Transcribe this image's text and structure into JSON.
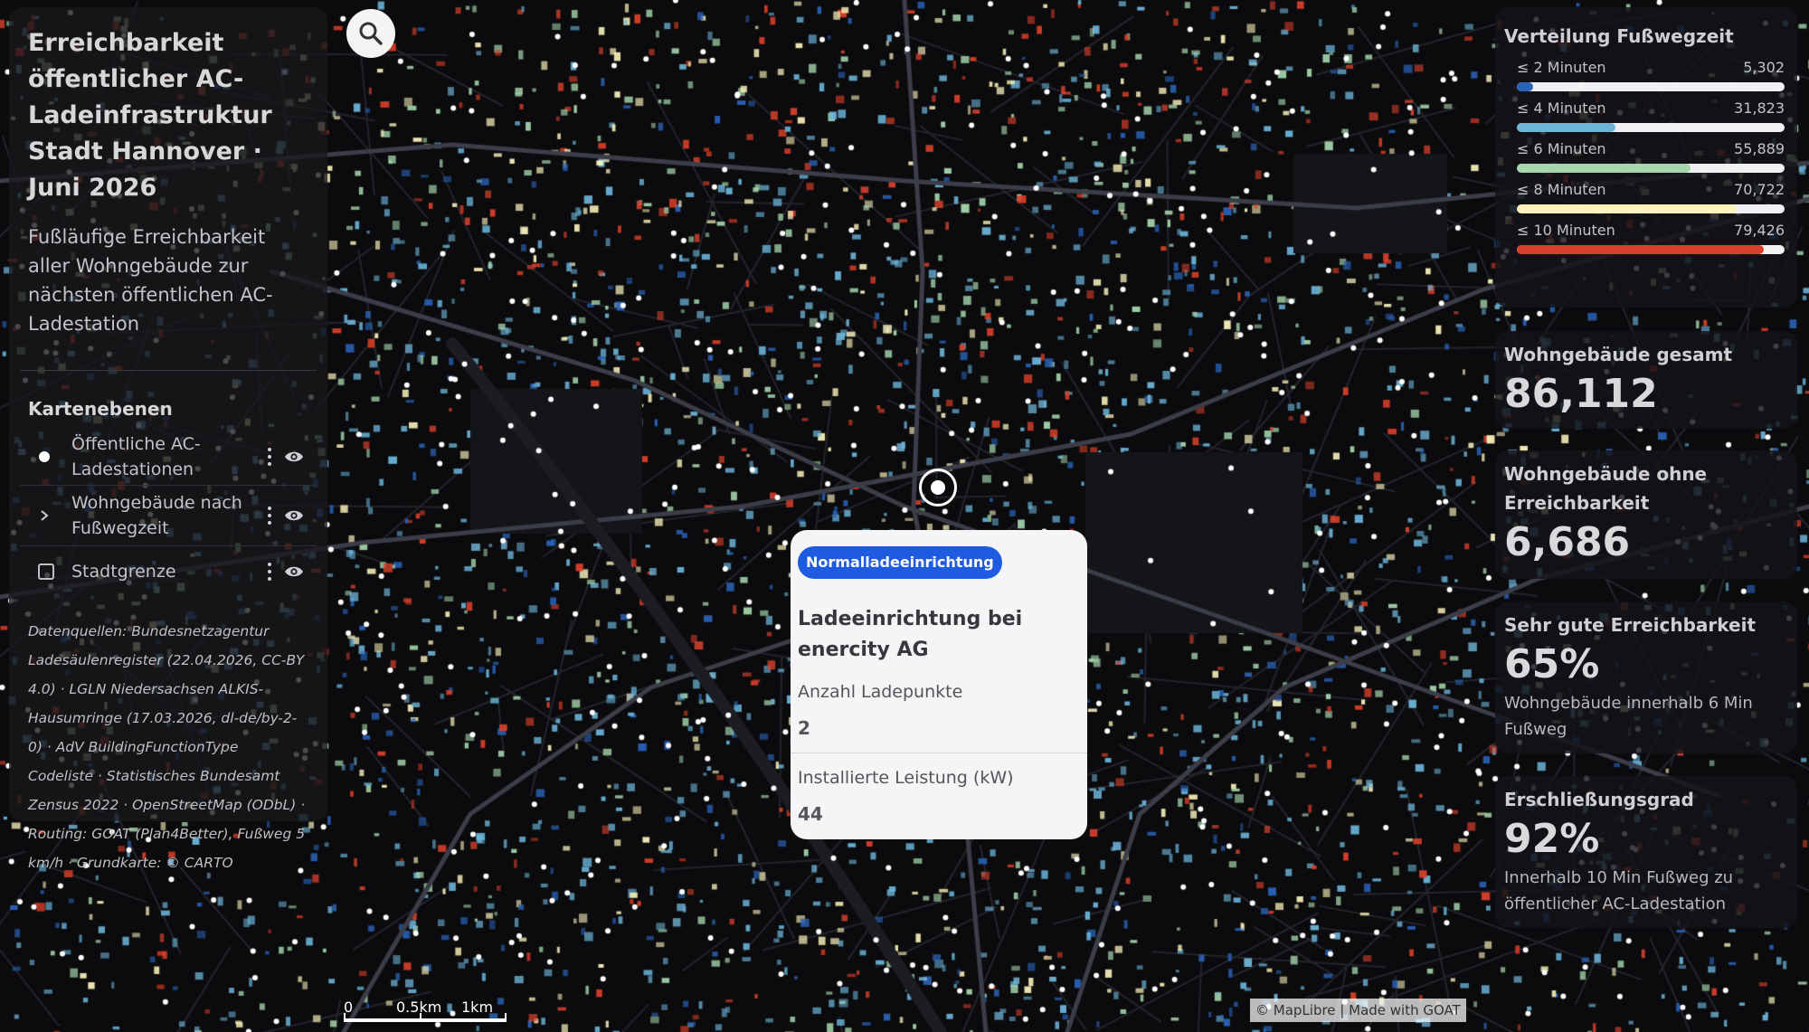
{
  "app": {
    "title": "Erreichbarkeit öffentlicher AC-Ladeinfrastruktur Stadt Hannover · Juni 2026",
    "subtitle": "Fußläufige Erreichbarkeit aller Wohngebäude zur nächsten öffentlichen AC-Ladestation"
  },
  "layers": {
    "heading": "Kartenebenen",
    "items": [
      {
        "label": "Öffentliche AC-Ladestationen",
        "leading_icon": "white-dot-icon"
      },
      {
        "label": "Wohngebäude nach Fußwegzeit",
        "leading_icon": "chevron-right-icon"
      },
      {
        "label": "Stadtgrenze",
        "leading_icon": "checkbox-icon"
      }
    ],
    "sources": "Datenquellen: Bundesnetzagentur Ladesäulenregister (22.04.2026, CC-BY 4.0) · LGLN Niedersachsen ALKIS-Hausumringe (17.03.2026, dl-de/by-2-0) · AdV BuildingFunctionType Codeliste · Statistisches Bundesamt Zensus 2022 · OpenStreetMap (ODbL) · Routing: GOAT (Plan4Better), Fußweg 5 km/h · Grundkarte: © CARTO"
  },
  "distribution": {
    "title": "Verteilung Fußwegzeit",
    "total": 86112,
    "rows": [
      {
        "label": "≤ 2 Minuten",
        "value_text": "5,302",
        "value": 5302,
        "color": "#2a63b8"
      },
      {
        "label": "≤ 4 Minuten",
        "value_text": "31,823",
        "value": 31823,
        "color": "#6db4d9"
      },
      {
        "label": "≤ 6 Minuten",
        "value_text": "55,889",
        "value": 55889,
        "color": "#a6d6ad"
      },
      {
        "label": "≤ 8 Minuten",
        "value_text": "70,722",
        "value": 70722,
        "color": "#fbf2bc"
      },
      {
        "label": "≤ 10 Minuten",
        "value_text": "79,426",
        "value": 79426,
        "color": "#d9402b"
      }
    ]
  },
  "stats": {
    "total_title": "Wohngebäude gesamt",
    "total_value": "86,112",
    "no_access_title": "Wohngebäude ohne Erreichbarkeit",
    "no_access_value": "6,686",
    "very_good_title": "Sehr gute Erreichbarkeit",
    "very_good_value": "65%",
    "very_good_desc": "Wohngebäude innerhalb 6 Min Fußweg",
    "coverage_title": "Erschließungsgrad",
    "coverage_value": "92%",
    "coverage_desc": "Innerhalb 10 Min Fußweg zu öffentlicher AC-Ladestation"
  },
  "popup": {
    "badge": "Normalladeeinrichtung",
    "title": "Ladeeinrichtung bei enercity AG",
    "field1_label": "Anzahl Ladepunkte",
    "field1_value": "2",
    "field2_label": "Installierte Leistung (kW)",
    "field2_value": "44"
  },
  "map": {
    "scale_labels": [
      "0",
      "0.5km",
      "1km"
    ],
    "attribution": "© MapLibre | Made with GOAT",
    "colors": {
      "background": "#0b0b0d",
      "road": "#3b3d48",
      "walk_2": "#2a63b8",
      "walk_4": "#6db4d9",
      "walk_6": "#a6d6ad",
      "walk_8": "#fbf2bc",
      "walk_10": "#d9402b",
      "station": "#ffffff"
    }
  }
}
